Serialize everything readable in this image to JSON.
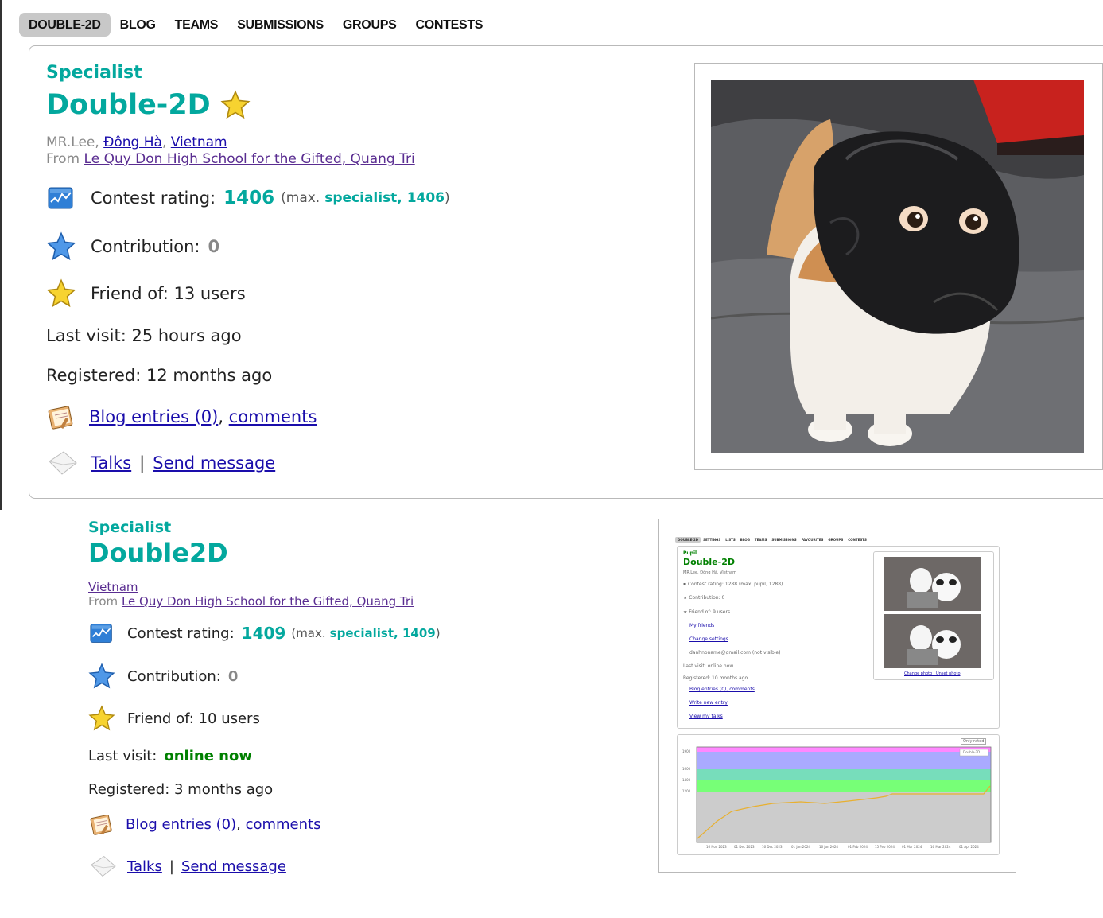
{
  "top_profile": {
    "nav_tabs": [
      {
        "label": "DOUBLE-2D",
        "active": true
      },
      {
        "label": "BLOG"
      },
      {
        "label": "TEAMS"
      },
      {
        "label": "SUBMISSIONS"
      },
      {
        "label": "GROUPS"
      },
      {
        "label": "CONTESTS"
      }
    ],
    "rank": "Specialist",
    "handle": "Double-2D",
    "name": "MR.Lee",
    "city": "Đông Hà",
    "country": "Vietnam",
    "from_label": "From",
    "organization": "Le Quy Don High School for the Gifted, Quang Tri",
    "contest_rating_label": "Contest rating:",
    "contest_rating_value": "1406",
    "max_prefix": "(max.",
    "max_rank_value": "specialist, 1406",
    "max_suffix": ")",
    "contribution_label": "Contribution:",
    "contribution_value": "0",
    "friend_of": "Friend of: 13 users",
    "last_visit": "Last visit: 25 hours ago",
    "registered": "Registered: 12 months ago",
    "blog_entries": "Blog entries (0)",
    "comments": "comments",
    "talks": "Talks",
    "separator": "|",
    "send_message": "Send message"
  },
  "bottom_profile": {
    "rank": "Specialist",
    "handle": "Double2D",
    "country": "Vietnam",
    "from_label": "From",
    "organization": "Le Quy Don High School for the Gifted, Quang Tri",
    "contest_rating_label": "Contest rating:",
    "contest_rating_value": "1409",
    "max_prefix": "(max.",
    "max_rank_value": "specialist, 1409",
    "max_suffix": ")",
    "contribution_label": "Contribution:",
    "contribution_value": "0",
    "friend_of": "Friend of: 10 users",
    "last_visit_label": "Last visit:",
    "last_visit_value": "online now",
    "registered": "Registered: 3 months ago",
    "blog_entries": "Blog entries (0)",
    "comments": "comments",
    "talks": "Talks",
    "separator": "|",
    "send_message": "Send message"
  },
  "embedded_screenshot": {
    "rank": "Pupil",
    "handle": "Double-2D",
    "location": "MR.Lee, Đông Hà, Vietnam",
    "contest_rating": "Contest rating: 1288 (max. pupil, 1288)",
    "contribution": "Contribution: 0",
    "friend_of": "Friend of: 9 users",
    "my_friends": "My friends",
    "change_settings": "Change settings",
    "email": "danhnoname@gmail.com (not visible)",
    "last_visit": "Last visit: online now",
    "registered": "Registered: 10 months ago",
    "blog_entries": "Blog entries (0), comments",
    "write_new_entry": "Write new entry",
    "view_my_talks": "View my talks",
    "photo_links": "Change photo | Unset photo",
    "only_rated": "Only rated",
    "legend": "Double-2D",
    "y_ticks": [
      "1900",
      "1600",
      "1400",
      "1200"
    ],
    "x_ticks": [
      "16 Nov 2023",
      "01 Dec 2023",
      "16 Dec 2023",
      "01 Jan 2024",
      "16 Jan 2024",
      "01 Feb 2024",
      "15 Feb 2024",
      "01 Mar 2024",
      "16 Mar 2024",
      "01 Apr 2024"
    ]
  },
  "colors": {
    "specialist": "#03a89e",
    "online": "#008000",
    "link": "#1a0dab",
    "visited_link": "#5a2d91"
  }
}
